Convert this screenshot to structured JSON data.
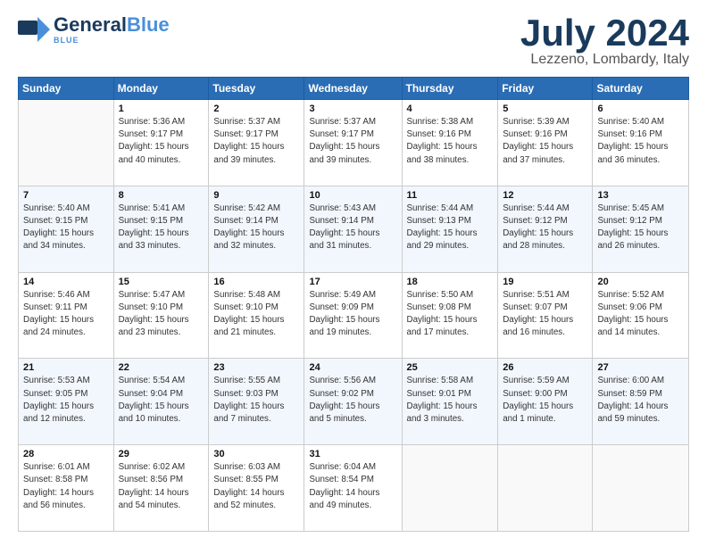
{
  "logo": {
    "name_part1": "General",
    "name_part2": "Blue",
    "tagline": "BLUE"
  },
  "title": "July 2024",
  "location": "Lezzeno, Lombardy, Italy",
  "days_of_week": [
    "Sunday",
    "Monday",
    "Tuesday",
    "Wednesday",
    "Thursday",
    "Friday",
    "Saturday"
  ],
  "weeks": [
    [
      {
        "day": "",
        "info": ""
      },
      {
        "day": "1",
        "info": "Sunrise: 5:36 AM\nSunset: 9:17 PM\nDaylight: 15 hours\nand 40 minutes."
      },
      {
        "day": "2",
        "info": "Sunrise: 5:37 AM\nSunset: 9:17 PM\nDaylight: 15 hours\nand 39 minutes."
      },
      {
        "day": "3",
        "info": "Sunrise: 5:37 AM\nSunset: 9:17 PM\nDaylight: 15 hours\nand 39 minutes."
      },
      {
        "day": "4",
        "info": "Sunrise: 5:38 AM\nSunset: 9:16 PM\nDaylight: 15 hours\nand 38 minutes."
      },
      {
        "day": "5",
        "info": "Sunrise: 5:39 AM\nSunset: 9:16 PM\nDaylight: 15 hours\nand 37 minutes."
      },
      {
        "day": "6",
        "info": "Sunrise: 5:40 AM\nSunset: 9:16 PM\nDaylight: 15 hours\nand 36 minutes."
      }
    ],
    [
      {
        "day": "7",
        "info": "Sunrise: 5:40 AM\nSunset: 9:15 PM\nDaylight: 15 hours\nand 34 minutes."
      },
      {
        "day": "8",
        "info": "Sunrise: 5:41 AM\nSunset: 9:15 PM\nDaylight: 15 hours\nand 33 minutes."
      },
      {
        "day": "9",
        "info": "Sunrise: 5:42 AM\nSunset: 9:14 PM\nDaylight: 15 hours\nand 32 minutes."
      },
      {
        "day": "10",
        "info": "Sunrise: 5:43 AM\nSunset: 9:14 PM\nDaylight: 15 hours\nand 31 minutes."
      },
      {
        "day": "11",
        "info": "Sunrise: 5:44 AM\nSunset: 9:13 PM\nDaylight: 15 hours\nand 29 minutes."
      },
      {
        "day": "12",
        "info": "Sunrise: 5:44 AM\nSunset: 9:12 PM\nDaylight: 15 hours\nand 28 minutes."
      },
      {
        "day": "13",
        "info": "Sunrise: 5:45 AM\nSunset: 9:12 PM\nDaylight: 15 hours\nand 26 minutes."
      }
    ],
    [
      {
        "day": "14",
        "info": "Sunrise: 5:46 AM\nSunset: 9:11 PM\nDaylight: 15 hours\nand 24 minutes."
      },
      {
        "day": "15",
        "info": "Sunrise: 5:47 AM\nSunset: 9:10 PM\nDaylight: 15 hours\nand 23 minutes."
      },
      {
        "day": "16",
        "info": "Sunrise: 5:48 AM\nSunset: 9:10 PM\nDaylight: 15 hours\nand 21 minutes."
      },
      {
        "day": "17",
        "info": "Sunrise: 5:49 AM\nSunset: 9:09 PM\nDaylight: 15 hours\nand 19 minutes."
      },
      {
        "day": "18",
        "info": "Sunrise: 5:50 AM\nSunset: 9:08 PM\nDaylight: 15 hours\nand 17 minutes."
      },
      {
        "day": "19",
        "info": "Sunrise: 5:51 AM\nSunset: 9:07 PM\nDaylight: 15 hours\nand 16 minutes."
      },
      {
        "day": "20",
        "info": "Sunrise: 5:52 AM\nSunset: 9:06 PM\nDaylight: 15 hours\nand 14 minutes."
      }
    ],
    [
      {
        "day": "21",
        "info": "Sunrise: 5:53 AM\nSunset: 9:05 PM\nDaylight: 15 hours\nand 12 minutes."
      },
      {
        "day": "22",
        "info": "Sunrise: 5:54 AM\nSunset: 9:04 PM\nDaylight: 15 hours\nand 10 minutes."
      },
      {
        "day": "23",
        "info": "Sunrise: 5:55 AM\nSunset: 9:03 PM\nDaylight: 15 hours\nand 7 minutes."
      },
      {
        "day": "24",
        "info": "Sunrise: 5:56 AM\nSunset: 9:02 PM\nDaylight: 15 hours\nand 5 minutes."
      },
      {
        "day": "25",
        "info": "Sunrise: 5:58 AM\nSunset: 9:01 PM\nDaylight: 15 hours\nand 3 minutes."
      },
      {
        "day": "26",
        "info": "Sunrise: 5:59 AM\nSunset: 9:00 PM\nDaylight: 15 hours\nand 1 minute."
      },
      {
        "day": "27",
        "info": "Sunrise: 6:00 AM\nSunset: 8:59 PM\nDaylight: 14 hours\nand 59 minutes."
      }
    ],
    [
      {
        "day": "28",
        "info": "Sunrise: 6:01 AM\nSunset: 8:58 PM\nDaylight: 14 hours\nand 56 minutes."
      },
      {
        "day": "29",
        "info": "Sunrise: 6:02 AM\nSunset: 8:56 PM\nDaylight: 14 hours\nand 54 minutes."
      },
      {
        "day": "30",
        "info": "Sunrise: 6:03 AM\nSunset: 8:55 PM\nDaylight: 14 hours\nand 52 minutes."
      },
      {
        "day": "31",
        "info": "Sunrise: 6:04 AM\nSunset: 8:54 PM\nDaylight: 14 hours\nand 49 minutes."
      },
      {
        "day": "",
        "info": ""
      },
      {
        "day": "",
        "info": ""
      },
      {
        "day": "",
        "info": ""
      }
    ]
  ]
}
